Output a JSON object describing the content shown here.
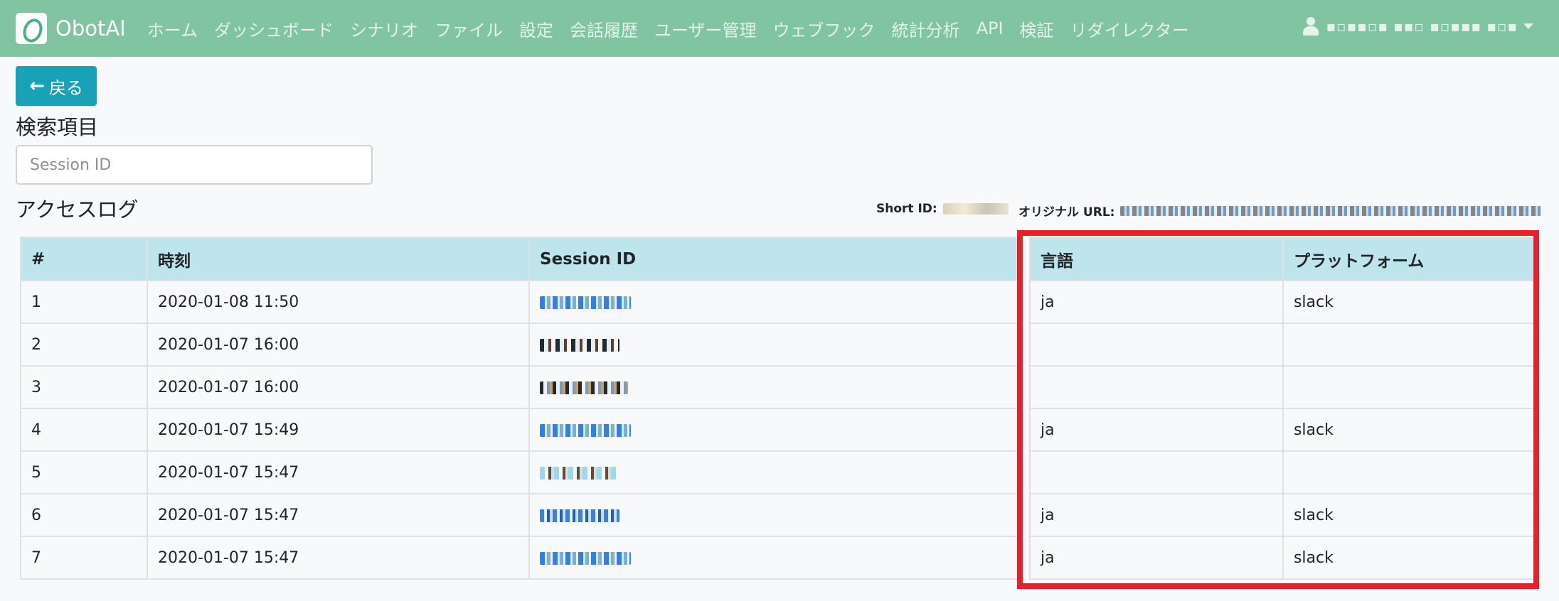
{
  "navbar": {
    "brand": "ObotAI",
    "links": [
      "ホーム",
      "ダッシュボード",
      "シナリオ",
      "ファイル",
      "設定",
      "会話履歴",
      "ユーザー管理",
      "ウェブフック",
      "統計分析",
      "API",
      "検証",
      "リダイレクター"
    ]
  },
  "actions": {
    "back_label": "戻る"
  },
  "search": {
    "title": "検索項目",
    "placeholder": "Session ID"
  },
  "access_log": {
    "title": "アクセスログ",
    "short_id_label": "Short ID:",
    "original_url_label": "オリジナル URL:",
    "columns": [
      "#",
      "時刻",
      "Session ID",
      "言語",
      "プラットフォーム"
    ],
    "rows": [
      {
        "num": "1",
        "time": "2020-01-08 11:50",
        "lang": "ja",
        "platform": "slack"
      },
      {
        "num": "2",
        "time": "2020-01-07 16:00",
        "lang": "",
        "platform": ""
      },
      {
        "num": "3",
        "time": "2020-01-07 16:00",
        "lang": "",
        "platform": ""
      },
      {
        "num": "4",
        "time": "2020-01-07 15:49",
        "lang": "ja",
        "platform": "slack"
      },
      {
        "num": "5",
        "time": "2020-01-07 15:47",
        "lang": "",
        "platform": ""
      },
      {
        "num": "6",
        "time": "2020-01-07 15:47",
        "lang": "ja",
        "platform": "slack"
      },
      {
        "num": "7",
        "time": "2020-01-07 15:47",
        "lang": "ja",
        "platform": "slack"
      }
    ]
  },
  "colors": {
    "navbar": "#80c4a1",
    "button": "#17a2b8",
    "table_header": "#bee5eb",
    "highlight": "#e8202b"
  }
}
